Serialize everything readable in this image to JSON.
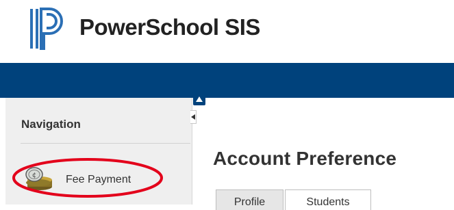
{
  "header": {
    "logo_text": "PowerSchool SIS",
    "logo_icon": "powerschool-logo-icon",
    "bar_color": "#00427c"
  },
  "sidebar": {
    "heading": "Navigation",
    "items": [
      {
        "label": "Fee Payment",
        "icon": "coins-icon",
        "highlighted": true
      }
    ],
    "highlight_color": "#e3001b"
  },
  "main": {
    "title": "Account Preference",
    "tabs": [
      {
        "label": "Profile"
      },
      {
        "label": "Students"
      }
    ]
  }
}
